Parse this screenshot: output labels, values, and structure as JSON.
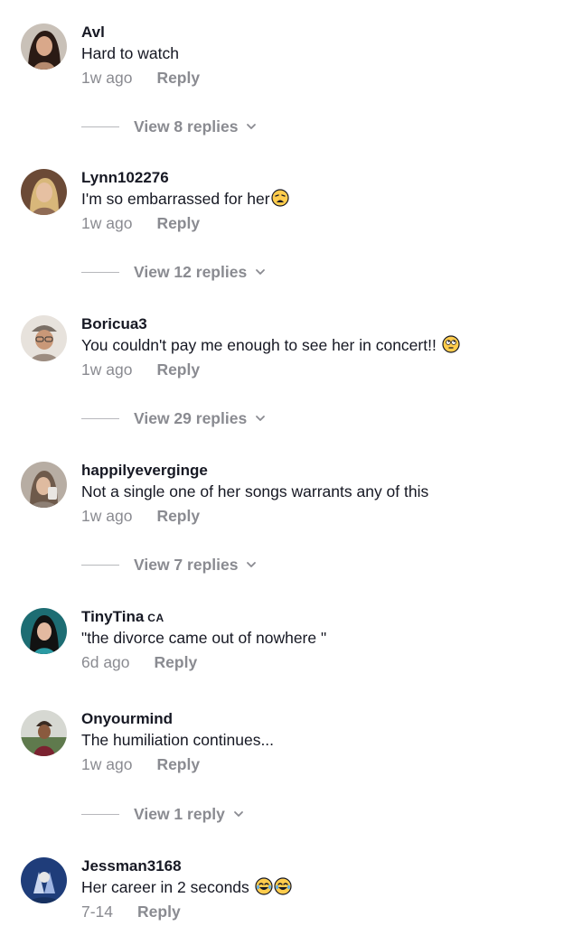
{
  "comments": [
    {
      "username": "Avl",
      "badge": "",
      "text": "Hard to watch",
      "emoji": [],
      "time": "1w ago",
      "reply_label": "Reply",
      "view_replies": "View 8 replies",
      "avatar_icon": "user-avatar-icon"
    },
    {
      "username": "Lynn102276",
      "badge": "",
      "text": "I'm so embarrassed for her",
      "emoji": [
        "weary-face-emoji"
      ],
      "time": "1w ago",
      "reply_label": "Reply",
      "view_replies": "View 12 replies",
      "avatar_icon": "user-avatar-icon"
    },
    {
      "username": "Boricua3",
      "badge": "",
      "text": "You couldn't pay me enough to see her in concert!!",
      "emoji": [
        "eye-roll-emoji"
      ],
      "time": "1w ago",
      "reply_label": "Reply",
      "view_replies": "View 29 replies",
      "avatar_icon": "user-avatar-icon"
    },
    {
      "username": "happilyeverginge",
      "badge": "",
      "text": "Not a single one of her songs warrants any of this",
      "emoji": [],
      "time": "1w ago",
      "reply_label": "Reply",
      "view_replies": "View 7 replies",
      "avatar_icon": "user-avatar-icon"
    },
    {
      "username": "TinyTina",
      "badge": "CA",
      "text": "\"the divorce came out of nowhere \"",
      "emoji": [],
      "time": "6d ago",
      "reply_label": "Reply",
      "view_replies": "",
      "avatar_icon": "user-avatar-icon"
    },
    {
      "username": "Onyourmind",
      "badge": "",
      "text": "The humiliation continues...",
      "emoji": [],
      "time": "1w ago",
      "reply_label": "Reply",
      "view_replies": "View 1 reply",
      "avatar_icon": "user-avatar-icon"
    },
    {
      "username": "Jessman3168",
      "badge": "",
      "text": "Her career in 2 seconds",
      "emoji": [
        "laughing-tears-emoji",
        "laughing-tears-emoji"
      ],
      "time": "7-14",
      "reply_label": "Reply",
      "view_replies": "",
      "avatar_icon": "user-avatar-icon"
    }
  ],
  "colors": {
    "primary_text": "#161823",
    "secondary_text": "#8a8b91",
    "divider": "#b7b8bc",
    "emoji_yellow": "#ffcc4d"
  }
}
